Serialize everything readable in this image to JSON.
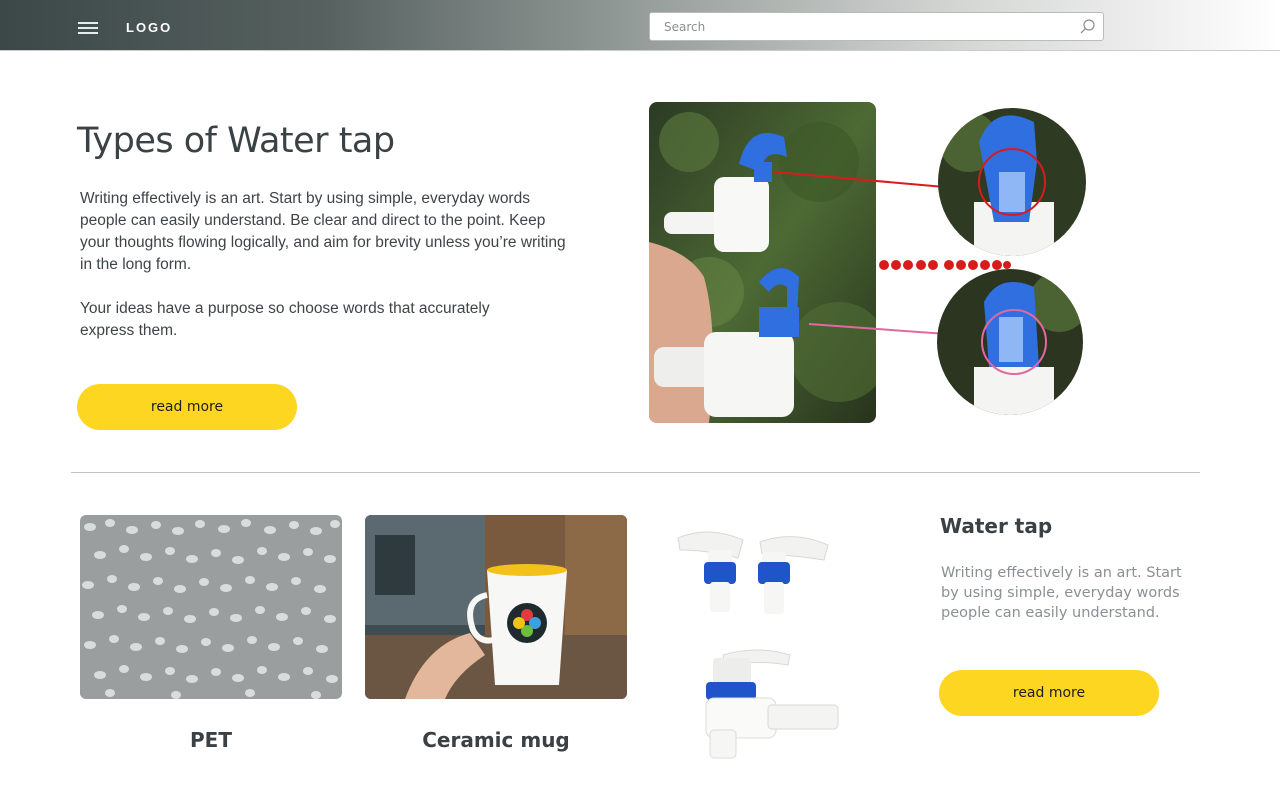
{
  "header": {
    "logo": "LOGO",
    "search_placeholder": "Search"
  },
  "hero": {
    "title": "Types of Water tap",
    "paragraph1": "Writing effectively is an art. Start by using simple, everyday words people can easily understand. Be clear and direct to the point. Keep your thoughts flowing logically, and aim for brevity unless you’re writing in the long form.",
    "paragraph2": "Your ideas have a purpose so choose words that accurately express them.",
    "button_label": "read more"
  },
  "cards": [
    {
      "label": "PET"
    },
    {
      "label": "Ceramic mug"
    }
  ],
  "side": {
    "title": "Water tap",
    "text": "Writing effectively is an art. Start by using simple, everyday words people can easily understand.",
    "button_label": "read more"
  },
  "colors": {
    "accent": "#fdd622",
    "tap_blue": "#2f6fe0",
    "text_dark": "#3a4044",
    "text_muted": "#8a9093"
  }
}
